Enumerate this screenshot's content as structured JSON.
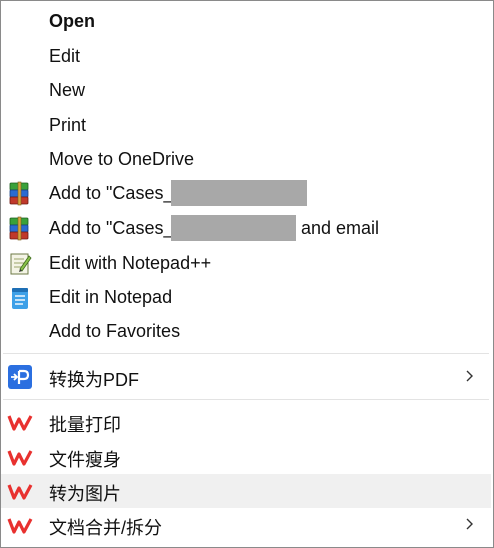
{
  "menu": {
    "items": [
      {
        "label": "Open"
      },
      {
        "label": "Edit"
      },
      {
        "label": "New"
      },
      {
        "label": "Print"
      },
      {
        "label": "Move to OneDrive"
      },
      {
        "label": "Add to \"Cases_"
      },
      {
        "label": "Add to \"Cases_",
        "suffix": "and email"
      },
      {
        "label": "Edit with Notepad++"
      },
      {
        "label": "Edit in Notepad"
      },
      {
        "label": "Add to Favorites"
      },
      {
        "label": "转换为PDF"
      },
      {
        "label": "批量打印"
      },
      {
        "label": "文件瘦身"
      },
      {
        "label": "转为图片"
      },
      {
        "label": "文档合并/拆分"
      }
    ]
  },
  "icons": {
    "winrar": "winrar-archive-icon",
    "notepadpp": "notepad-plus-plus-icon",
    "notepad": "notepad-icon",
    "pdf": "pdf-convert-icon",
    "wps": "wps-office-icon",
    "submenu": "chevron-right-icon"
  },
  "colors": {
    "wps_red": "#e8312f",
    "pdf_blue": "#2b6fe0",
    "highlight": "#f0f0f0"
  }
}
